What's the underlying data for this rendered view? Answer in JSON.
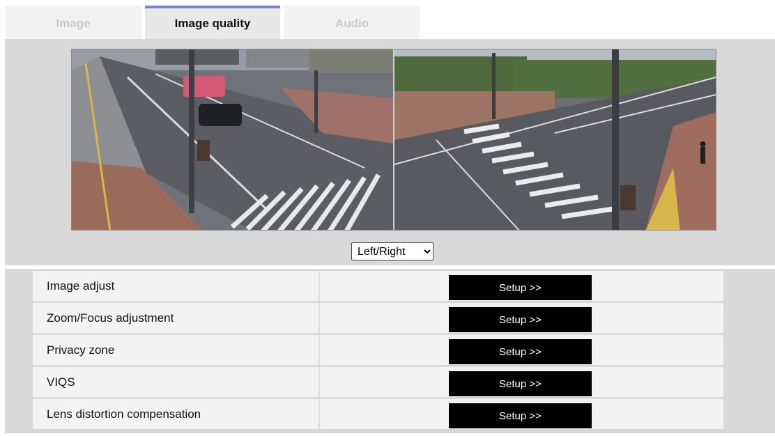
{
  "tabs": [
    {
      "label": "Image",
      "active": false
    },
    {
      "label": "Image quality",
      "active": true
    },
    {
      "label": "Audio",
      "active": false
    }
  ],
  "preview": {
    "view_mode": {
      "selected": "Left/Right"
    }
  },
  "settings": {
    "rows": [
      {
        "label": "Image adjust",
        "button": "Setup >>"
      },
      {
        "label": "Zoom/Focus adjustment",
        "button": "Setup >>"
      },
      {
        "label": "Privacy zone",
        "button": "Setup >>"
      },
      {
        "label": "VIQS",
        "button": "Setup >>"
      },
      {
        "label": "Lens distortion compensation",
        "button": "Setup >>"
      }
    ]
  },
  "colors": {
    "active_tab_accent": "#7b7fd6",
    "button_bg": "#000000",
    "panel_bg": "#d9d9d9"
  }
}
